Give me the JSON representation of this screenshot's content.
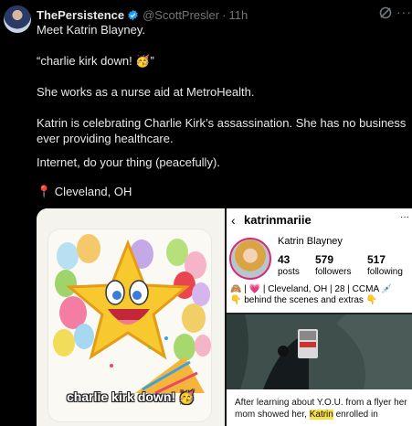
{
  "tweet": {
    "display_name": "ThePersistence",
    "handle": "@ScottPresler",
    "separator": "·",
    "time": "11h",
    "lines": [
      "Meet Katrin Blayney.",
      "“charlie kirk down! 🥳”",
      "She works as a nurse aid at MetroHealth.",
      "Katrin is celebrating Charlie Kirk’s assassination. She has no business ever providing healthcare.",
      "Internet, do your thing (peacefully).",
      "📍 Cleveland, OH"
    ],
    "icons": {
      "avatar": "avatar-photo",
      "verified": "verified-badge-icon",
      "grok": "grok-icon",
      "more": "more-icon"
    }
  },
  "media": {
    "left": {
      "sticker_caption": "charlie kirk down! 🥳"
    },
    "right": {
      "back_glyph": "‹",
      "username": "katrinmariie",
      "more_glyph": "···",
      "name": "Katrin Blayney",
      "stats": [
        {
          "value": "43",
          "label": "posts"
        },
        {
          "value": "579",
          "label": "followers"
        },
        {
          "value": "517",
          "label": "following"
        }
      ],
      "bio_line1": "🙈 | 💗 | Cleveland, OH | 28 | CCMA 💉",
      "bio_line2": "👇 behind the scenes and extras 👇",
      "caption_part1": "After learning about Y.O.U. from a flyer her mom showed her, ",
      "caption_highlight": "Katrin",
      "caption_part2": " enrolled in"
    }
  },
  "colors": {
    "background": "#000000",
    "text": "#e7e9ea",
    "muted": "#71767b",
    "verified": "#1d9bf0"
  }
}
